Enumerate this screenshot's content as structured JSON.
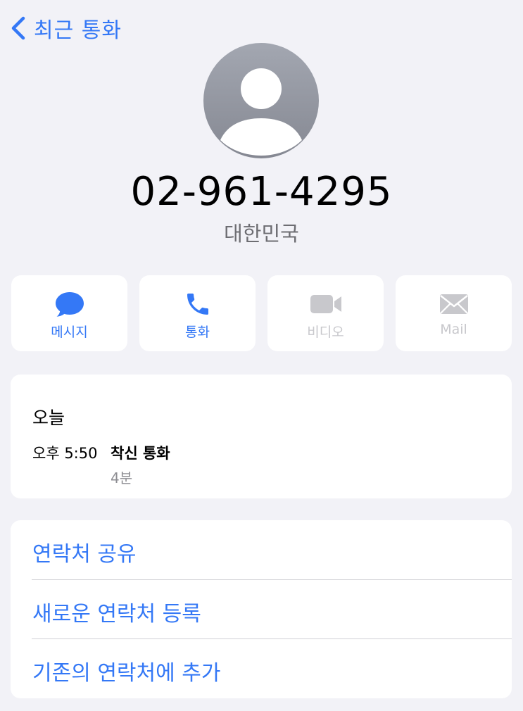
{
  "nav": {
    "back_label": "최근 통화",
    "back_icon": "chevron-left-icon"
  },
  "contact": {
    "avatar_icon": "person-silhouette-icon",
    "phone_number": "02-961-4295",
    "country": "대한민국"
  },
  "actions": [
    {
      "label": "메시지",
      "icon": "message-bubble-icon",
      "enabled": true
    },
    {
      "label": "통화",
      "icon": "phone-icon",
      "enabled": true
    },
    {
      "label": "비디오",
      "icon": "video-camera-icon",
      "enabled": false
    },
    {
      "label": "Mail",
      "icon": "envelope-icon",
      "enabled": false
    }
  ],
  "call_log": {
    "day": "오늘",
    "entries": [
      {
        "time": "오후 5:50",
        "type": "착신 통화",
        "duration": "4분"
      }
    ]
  },
  "menu": [
    {
      "label": "연락처 공유"
    },
    {
      "label": "새로운 연락처 등록"
    },
    {
      "label": "기존의 연락처에 추가"
    }
  ],
  "colors": {
    "accent": "#3478f6",
    "background": "#f2f2f7",
    "card": "#ffffff",
    "disabled": "#c8c8cc",
    "secondary_text": "#8e8e93"
  }
}
